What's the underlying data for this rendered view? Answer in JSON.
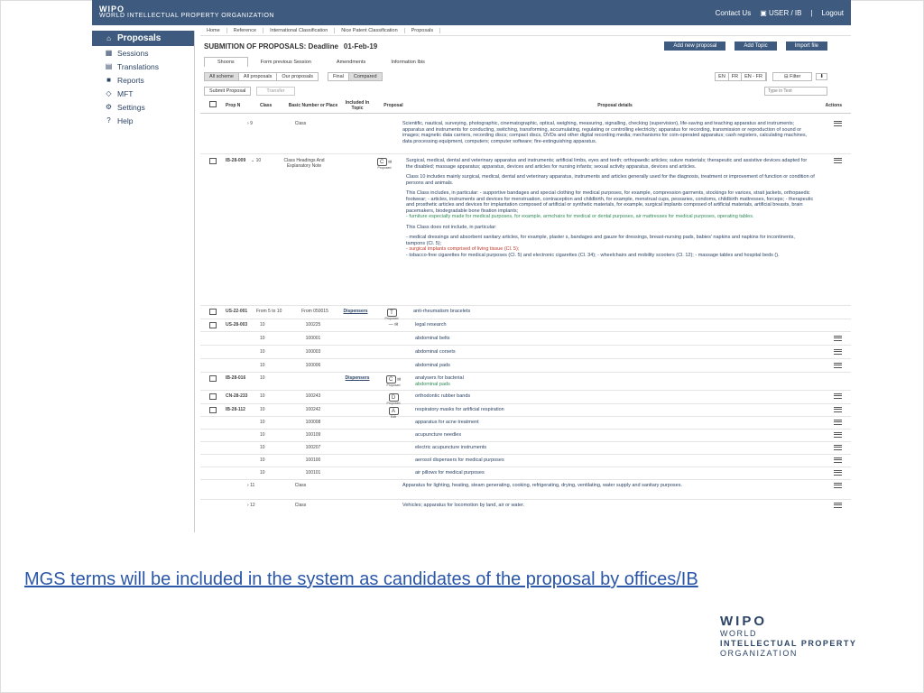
{
  "header": {
    "org_short": "WIPO",
    "org_long": "WORLD INTELLECTUAL PROPERTY ORGANIZATION",
    "contact": "Contact Us",
    "user": "USER / IB",
    "logout": "Logout"
  },
  "sidebar": {
    "items": [
      {
        "label": "Proposals",
        "icon": "home-icon"
      },
      {
        "label": "Sessions",
        "icon": "calendar-icon"
      },
      {
        "label": "Translations",
        "icon": "grid-icon"
      },
      {
        "label": "Reports",
        "icon": "folder-icon"
      },
      {
        "label": "MFT",
        "icon": "diamond-icon"
      },
      {
        "label": "Settings",
        "icon": "gear-icon"
      },
      {
        "label": "Help",
        "icon": "help-icon"
      }
    ]
  },
  "crumbs": [
    "Home",
    "Reference",
    "International Classification",
    "Nice Patent Classification",
    "Proposals"
  ],
  "title": {
    "label": "SUBMITION OF PROPOSALS: Deadline",
    "date": "01-Feb-19"
  },
  "buttons": {
    "add_proposal": "Add new proposal",
    "add_topic": "Add Topic",
    "import": "Import file"
  },
  "tabs": [
    "Shoons",
    "Form previous Session",
    "Amendments",
    "Information Ibis"
  ],
  "filter": {
    "seg1": [
      "All scheme",
      "All proposals",
      "Our proposals"
    ],
    "seg2": [
      "Final",
      "Compared"
    ],
    "langs": [
      "EN",
      "FR",
      "EN - FR"
    ],
    "filter_label": "Filter"
  },
  "submit": {
    "submit": "Submit Proposal",
    "transfer": "Transfer",
    "typein": "Type in Text"
  },
  "table": {
    "headers": {
      "prop": "Prop N",
      "class": "Class",
      "basic": "Basic Number or Place",
      "included": "Included In Topic",
      "proposal": "Proposal",
      "details": "Proposal details",
      "actions": "Actions"
    },
    "row1": {
      "class": "9",
      "basic": "Class",
      "details": "Scientific, nautical, surveying, photographic, cinematographic, optical, weighing, measuring, signalling, checking (supervision), life-saving and teaching apparatus and instruments; apparatus and instruments for conducting, switching, transforming, accumulating, regulating or controlling electricity; apparatus for recording, transmission or reproduction of sound or images; magnetic data carriers, recording discs; compact discs, DVDs and other digital recording media; mechanisms for coin-operated apparatus; cash registers, calculating machines, data processing equipment, computers; computer software; fire-extinguishing apparatus."
    },
    "row2": {
      "prop": "IB-28-009",
      "class": "10",
      "basic": "Class Headings And Explanatory Note",
      "letter": "C",
      "status": "Proposed",
      "d1": "Surgical, medical, dental and veterinary apparatus and instruments; artificial limbs, eyes and teeth; orthopaedic articles; suture materials; therapeutic and assistive devices adapted for the disabled; massage apparatus; apparatus, devices and articles for nursing infants; sexual activity apparatus, devices and articles.",
      "d2": "Class 10 includes mainly surgical, medical, dental and veterinary apparatus, instruments and articles generally used for the diagnosis, treatment or improvement of function or condition of persons and animals.",
      "d3": "This Class includes, in particular: - supportive bandages and special clothing for medical purposes, for example, compression garments, stockings for varices, strait jackets, orthopaedic footwear; - articles, instruments and devices for menstruation, contraception and childbirth, for example, menstrual cups, pessaries, condoms, childbirth mattresses, forceps; - therapeutic and prosthetic articles and devices for implantation composed of artificial or synthetic materials, for example, surgical implants composed of artificial materials, artificial breasts, brain pacemakers, biodegradable bone fixation implants;",
      "d3g": "- furniture especially made for medical purposes, for example, armchairs for medical or dental purposes, air mattresses for medical purposes, operating tables.",
      "d4": "This Class does not include, in particular:",
      "d5": "- medical dressings and absorbent sanitary articles, for example, plaster s, bandages and gauze for dressings, breast-nursing pads, babies' napkins and napkins for incontinents, tampons (Cl. 5);",
      "d5r": "- surgical implants comprised of living tissue (Cl. 5);",
      "d6": "- tobacco-free cigarettes for medical purposes (Cl. 5) and electronic cigarettes (Cl. 34); - wheelchairs and mobility scooters (Cl. 12); - massage tables and hospital beds ()."
    },
    "row3": {
      "prop": "US-22-001",
      "class": "From 5 to 10",
      "basic": "From 050015",
      "included": "Dispensers",
      "letter": "T",
      "status": "Proposed",
      "details": "anti-rheumatism bracelets"
    },
    "row4": {
      "prop": "US-28-003",
      "class": "10",
      "basic": "100225",
      "dash": "—",
      "details": "legal research"
    },
    "row5": {
      "class": "10",
      "basic": "100001",
      "details": "abdominal belts"
    },
    "row6": {
      "class": "10",
      "basic": "100003",
      "details": "abdominal corsets"
    },
    "row7": {
      "class": "10",
      "basic": "100006",
      "details": "abdominal pads"
    },
    "row8": {
      "prop": "IB-28-016",
      "class": "10",
      "included": "Dispensers",
      "letter": "C",
      "status": "Proposed",
      "d1": "analysers for bacterial",
      "d2": "abdominal pads"
    },
    "row9": {
      "prop": "CN-28-233",
      "class": "10",
      "basic": "100243",
      "letter": "D",
      "status": "Proposed",
      "details": "orthodontic rubber bands"
    },
    "row10": {
      "prop": "IB-28-112",
      "class": "10",
      "basic": "100242",
      "letter": "A",
      "status": "Edit",
      "details": "respiratory masks for artificial respiration"
    },
    "row11": {
      "class": "10",
      "basic": "100008",
      "details": "apparatus for acne treatment"
    },
    "row12": {
      "class": "10",
      "basic": "100109",
      "details": "acupuncture needles"
    },
    "row13": {
      "class": "10",
      "basic": "100207",
      "details": "electric acupuncture instruments"
    },
    "row14": {
      "class": "10",
      "basic": "100100",
      "details": "aerosol dispensers for medical purposes"
    },
    "row15": {
      "class": "10",
      "basic": "100101",
      "details": "air pillows for medical purposes"
    },
    "row16": {
      "class": "11",
      "basic": "Class",
      "details": "Apparatus for lighting, heating, steam generating, cooking, refrigerating, drying, ventilating, water supply and sanitary purposes."
    },
    "row17": {
      "class": "12",
      "basic": "Class",
      "details": "Vehicles; apparatus for locomotion by land, air or water."
    }
  },
  "caption": "MGS terms will be included in the system as candidates of the proposal by offices/IB",
  "logo": {
    "short": "WIPO",
    "l1": "WORLD",
    "l2": "INTELLECTUAL PROPERTY",
    "l3": "ORGANIZATION"
  },
  "colors": {
    "brand": "#3e5b7f",
    "link": "#2a56a8",
    "red": "#c0392b",
    "green": "#2e8b57"
  }
}
